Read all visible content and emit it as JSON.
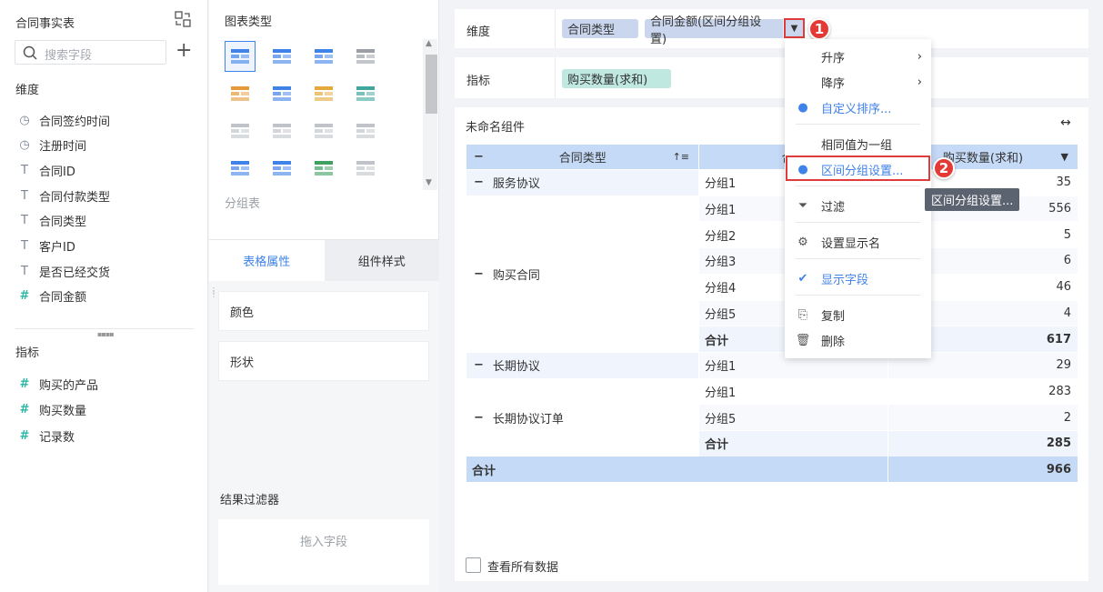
{
  "left": {
    "title": "合同事实表",
    "search_placeholder": "搜索字段",
    "dim_title": "维度",
    "dims": [
      {
        "icon": "clock-icon",
        "g": "◷",
        "label": "合同签约时间"
      },
      {
        "icon": "clock-icon",
        "g": "◷",
        "label": "注册时间"
      },
      {
        "icon": "text-icon",
        "g": "T",
        "label": "合同ID"
      },
      {
        "icon": "text-icon",
        "g": "T",
        "label": "合同付款类型"
      },
      {
        "icon": "text-icon",
        "g": "T",
        "label": "合同类型"
      },
      {
        "icon": "text-icon",
        "g": "T",
        "label": "客户ID"
      },
      {
        "icon": "text-icon",
        "g": "T",
        "label": "是否已经交货"
      },
      {
        "icon": "hash-icon",
        "g": "#",
        "label": "合同金额"
      }
    ],
    "met_title": "指标",
    "mets": [
      {
        "label": "购买的产品"
      },
      {
        "label": "购买数量"
      },
      {
        "label": "记录数"
      }
    ]
  },
  "mid": {
    "title": "图表类型",
    "chart_label": "分组表",
    "tab1": "表格属性",
    "tab2": "组件样式",
    "prop1": "颜色",
    "prop2": "形状",
    "filter_title": "结果过滤器",
    "drop_hint": "拖入字段"
  },
  "right": {
    "dim_label": "维度",
    "dim_pill1": "合同类型",
    "dim_pill2": "合同金额(区间分组设置)",
    "met_label": "指标",
    "met_pill": "购买数量(求和)",
    "widget_title": "未命名组件",
    "checkbox": "查看所有数据",
    "table": {
      "h1": "合同类型",
      "h2": "合同",
      "h3": "购买数量(求和)",
      "rows": [
        [
          "服务协议",
          "分组1",
          "35"
        ],
        [
          "",
          "分组1",
          "556"
        ],
        [
          "",
          "分组2",
          "5"
        ],
        [
          "购买合同",
          "分组3",
          "6"
        ],
        [
          "",
          "分组4",
          "46"
        ],
        [
          "",
          "分组5",
          "4"
        ],
        [
          "",
          "合计",
          "617"
        ],
        [
          "长期协议",
          "分组1",
          "29"
        ],
        [
          "",
          "分组1",
          "283"
        ],
        [
          "长期协议订单",
          "分组5",
          "2"
        ],
        [
          "",
          "合计",
          "285"
        ]
      ],
      "total_label": "合计",
      "total_value": "966"
    }
  },
  "menu": {
    "asc": "升序",
    "desc": "降序",
    "custom_sort": "自定义排序...",
    "same_group": "相同值为一组",
    "range_group": "区间分组设置...",
    "filter": "过滤",
    "display_name": "设置显示名",
    "show_field": "显示字段",
    "copy": "复制",
    "delete": "删除",
    "tooltip": "区间分组设置..."
  },
  "badges": {
    "b1": "1",
    "b2": "2"
  }
}
